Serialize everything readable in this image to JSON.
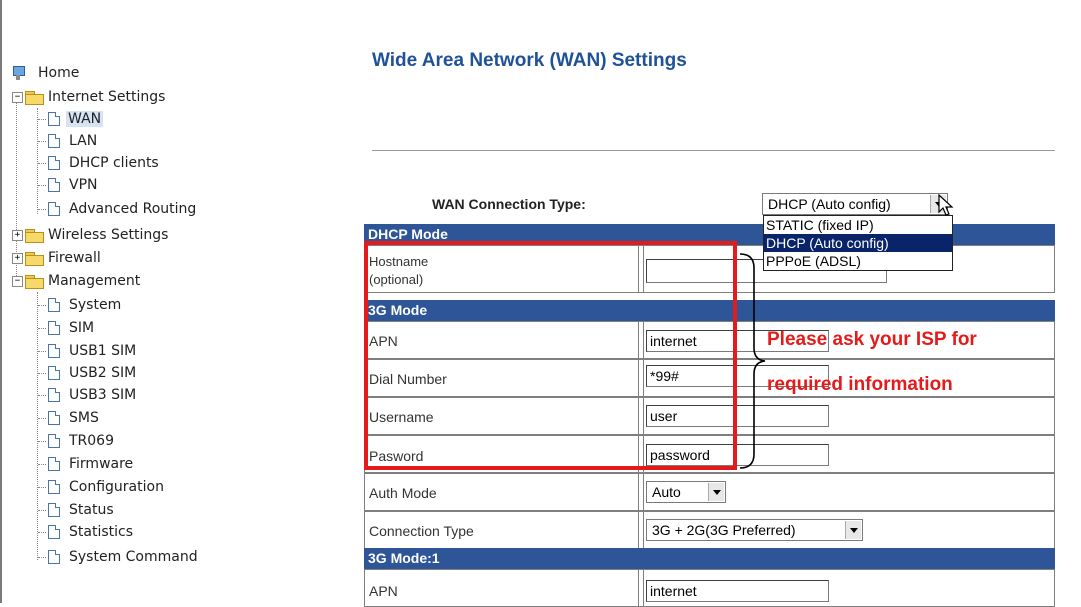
{
  "nav": {
    "home": "Home",
    "internet_settings": "Internet Settings",
    "internet_children": [
      "WAN",
      "LAN",
      "DHCP clients",
      "VPN",
      "Advanced Routing"
    ],
    "wireless_settings": "Wireless Settings",
    "firewall": "Firewall",
    "management": "Management",
    "management_children": [
      "System",
      "SIM",
      "USB1 SIM",
      "USB2 SIM",
      "USB3 SIM",
      "SMS",
      "TR069",
      "Firmware",
      "Configuration",
      "Status",
      "Statistics",
      "System Command"
    ],
    "selected": "WAN"
  },
  "page": {
    "title": "Wide Area Network (WAN) Settings"
  },
  "wan": {
    "connection_type_label": "WAN Connection Type:",
    "connection_type_value": "DHCP (Auto config)",
    "connection_type_options": [
      "STATIC (fixed IP)",
      "DHCP (Auto config)",
      "PPPoE (ADSL)"
    ]
  },
  "dhcp_mode": {
    "header": "DHCP Mode",
    "hostname_label": "Hostname",
    "hostname_sub": "(optional)",
    "hostname_value": ""
  },
  "g3_mode": {
    "header": "3G Mode",
    "apn_label": "APN",
    "apn_value": "internet",
    "dial_label": "Dial Number",
    "dial_value": "*99#",
    "username_label": "Username",
    "username_value": "user",
    "password_label": "Pasword",
    "password_value": "password",
    "auth_label": "Auth Mode",
    "auth_value": "Auto",
    "conn_label": "Connection Type",
    "conn_value": "3G + 2G(3G Preferred)"
  },
  "g3_mode_1": {
    "header": "3G Mode:1",
    "apn_label": "APN",
    "apn_value": "internet"
  },
  "annotation": {
    "line1": "Please ask your ISP for",
    "line2": "required information"
  },
  "colors": {
    "title": "#1f5297",
    "section_header": "#2e5597",
    "annotation": "#e41b1b"
  }
}
